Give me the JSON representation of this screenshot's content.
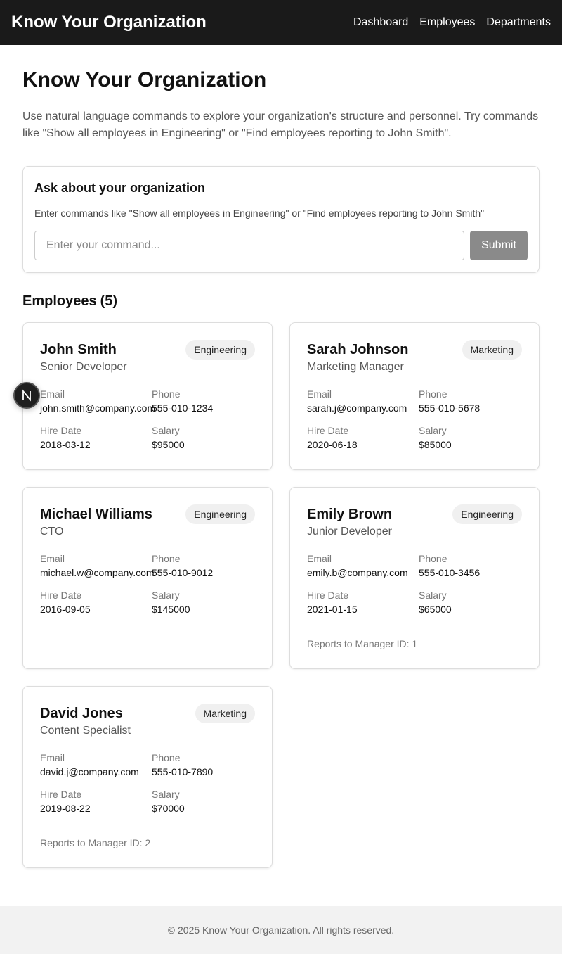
{
  "header": {
    "brand": "Know Your Organization",
    "nav": [
      "Dashboard",
      "Employees",
      "Departments"
    ]
  },
  "main": {
    "title": "Know Your Organization",
    "intro": "Use natural language commands to explore your organization's structure and personnel. Try commands like \"Show all employees in Engineering\" or \"Find employees reporting to John Smith\"."
  },
  "ask": {
    "title": "Ask about your organization",
    "hint": "Enter commands like \"Show all employees in Engineering\" or \"Find employees reporting to John Smith\"",
    "placeholder": "Enter your command...",
    "submit_label": "Submit"
  },
  "employees_section": {
    "label": "Employees",
    "count": "(5)"
  },
  "field_labels": {
    "email": "Email",
    "phone": "Phone",
    "hire_date": "Hire Date",
    "salary": "Salary"
  },
  "employees": [
    {
      "name": "John Smith",
      "role": "Senior Developer",
      "department": "Engineering",
      "email": "john.smith@company.com",
      "phone": "555-010-1234",
      "hire_date": "2018-03-12",
      "salary": "$95000"
    },
    {
      "name": "Sarah Johnson",
      "role": "Marketing Manager",
      "department": "Marketing",
      "email": "sarah.j@company.com",
      "phone": "555-010-5678",
      "hire_date": "2020-06-18",
      "salary": "$85000"
    },
    {
      "name": "Michael Williams",
      "role": "CTO",
      "department": "Engineering",
      "email": "michael.w@company.com",
      "phone": "555-010-9012",
      "hire_date": "2016-09-05",
      "salary": "$145000"
    },
    {
      "name": "Emily Brown",
      "role": "Junior Developer",
      "department": "Engineering",
      "email": "emily.b@company.com",
      "phone": "555-010-3456",
      "hire_date": "2021-01-15",
      "salary": "$65000",
      "reports_to": "Reports to Manager ID: 1"
    },
    {
      "name": "David Jones",
      "role": "Content Specialist",
      "department": "Marketing",
      "email": "david.j@company.com",
      "phone": "555-010-7890",
      "hire_date": "2019-08-22",
      "salary": "$70000",
      "reports_to": "Reports to Manager ID: 2"
    }
  ],
  "footer": {
    "text": "© 2025 Know Your Organization. All rights reserved."
  },
  "dev_badge": {
    "letter": "N",
    "icon": "nextjs-icon"
  },
  "colors": {
    "header_bg": "#1a1a1a",
    "submit_bg": "#8a8a8a",
    "badge_bg": "#f0f0f0",
    "footer_bg": "#f2f2f2"
  }
}
